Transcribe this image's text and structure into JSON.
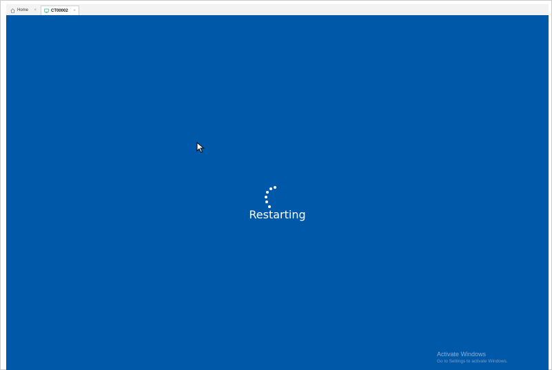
{
  "tabs": [
    {
      "label": "Home",
      "icon": "home-icon",
      "close": "×"
    },
    {
      "label": "CT00002",
      "icon": "vm-icon",
      "close": "×"
    }
  ],
  "screen": {
    "background": "#0058a8",
    "status_text": "Restarting",
    "watermark_title": "Activate Windows",
    "watermark_subtitle": "Go to Settings to activate Windows."
  }
}
